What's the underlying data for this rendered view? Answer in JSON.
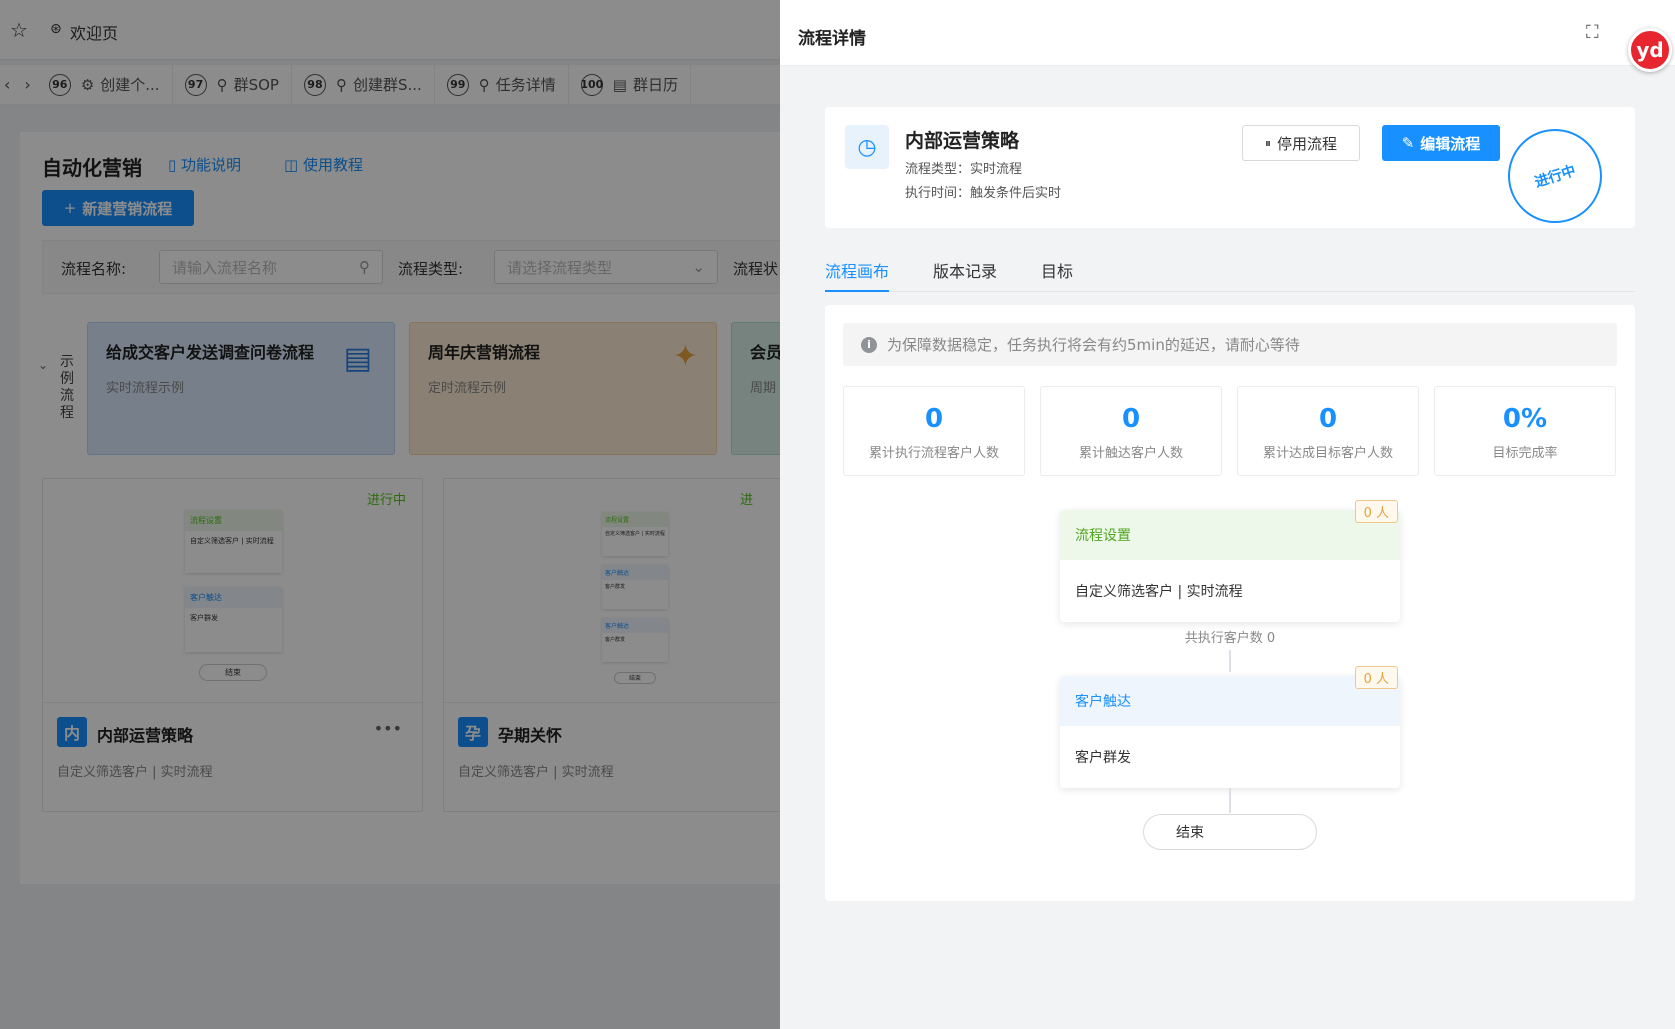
{
  "header": {
    "welcome_label": "欢迎页"
  },
  "tab_bar": {
    "tabs": [
      {
        "num": "96",
        "label": "创建个..."
      },
      {
        "num": "97",
        "label": "群SOP"
      },
      {
        "num": "98",
        "label": "创建群S..."
      },
      {
        "num": "99",
        "label": "任务详情"
      },
      {
        "num": "100",
        "label": "群日历"
      }
    ]
  },
  "page": {
    "title": "自动化营销",
    "help_link": "功能说明",
    "tutorial_link": "使用教程",
    "new_button": "新建营销流程",
    "filter_name_label": "流程名称:",
    "filter_name_placeholder": "请输入流程名称",
    "filter_type_label": "流程类型:",
    "filter_type_placeholder": "请选择流程类型",
    "filter_status_label": "流程状",
    "example_label": "示例流程",
    "templates": [
      {
        "title": "给成交客户发送调查问卷流程",
        "subtitle": "实时流程示例"
      },
      {
        "title": "周年庆营销流程",
        "subtitle": "定时流程示例"
      },
      {
        "title": "会员",
        "subtitle": "周期"
      }
    ],
    "flows": [
      {
        "status": "进行中",
        "avatar": "内",
        "name": "内部运营策略",
        "desc": "自定义筛选客户 | 实时流程",
        "preview": {
          "n1_title": "流程设置",
          "n1_body": "自定义筛选客户 | 实时流程",
          "n2_title": "客户触达",
          "n2_body": "客户群发",
          "end": "结束"
        }
      },
      {
        "status": "进",
        "avatar": "孕",
        "name": "孕期关怀",
        "desc": "自定义筛选客户 | 实时流程",
        "preview": {
          "n1_title": "流程设置",
          "n1_body": "自定义筛选客户 | 实时流程",
          "n2_title": "客户触达",
          "n2_body": "客户群发",
          "n3_title": "客户触达",
          "n3_body": "客户群发",
          "end": "结束"
        }
      }
    ]
  },
  "drawer": {
    "title": "流程详情",
    "avatar_text": "yd",
    "flow_name": "内部运营策略",
    "flow_type": "流程类型：实时流程",
    "exec_time": "执行时间：触发条件后实时",
    "stop_button": "停用流程",
    "edit_button": "编辑流程",
    "status_stamp": "进行中",
    "tabs": [
      "流程画布",
      "版本记录",
      "目标"
    ],
    "notice": "为保障数据稳定，任务执行将会有约5min的延迟，请耐心等待",
    "stats": [
      {
        "value": "0",
        "label": "累计执行流程客户人数"
      },
      {
        "value": "0",
        "label": "累计触达客户人数"
      },
      {
        "value": "0",
        "label": "累计达成目标客户人数"
      },
      {
        "value": "0%",
        "label": "目标完成率"
      }
    ],
    "nodes": [
      {
        "title": "流程设置",
        "body": "自定义筛选客户 | 实时流程",
        "badge": "0 人"
      },
      {
        "title": "客户触达",
        "body": "客户群发",
        "badge": "0 人"
      }
    ],
    "exec_count": "共执行客户数 0",
    "end_label": "结束"
  },
  "colors": {
    "primary": "#1890ff",
    "success": "#52c41a",
    "warning": "#e6a23c"
  }
}
